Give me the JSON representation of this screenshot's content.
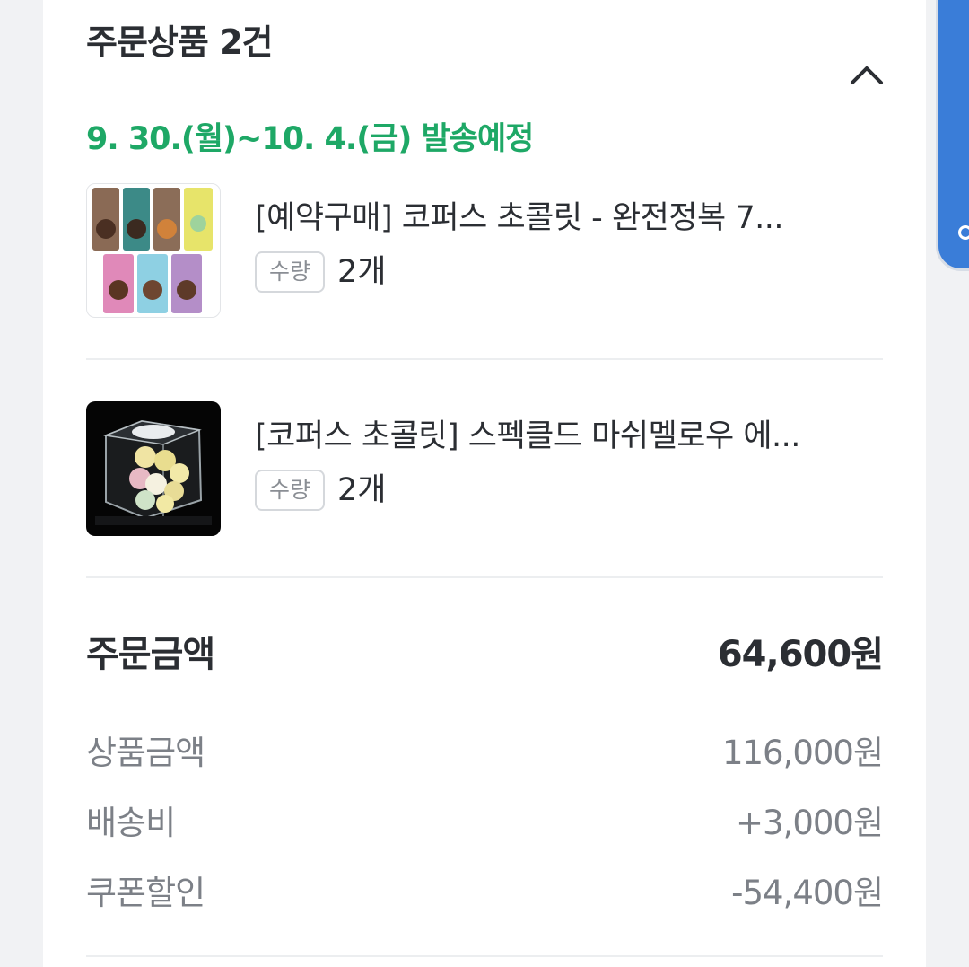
{
  "order": {
    "section_title": "주문상품 2건",
    "ship_date": "9. 30.(월)~10. 4.(금) 발송예정",
    "items": [
      {
        "name": "[예약구매] 코퍼스 초콜릿 - 완전정복 7...",
        "qty_label": "수량",
        "qty_value": "2개"
      },
      {
        "name": "[코퍼스 초콜릿] 스펙클드 마쉬멜로우 에...",
        "qty_label": "수량",
        "qty_value": "2개"
      }
    ]
  },
  "summary": {
    "total_label": "주문금액",
    "total_value": "64,600원",
    "product_label": "상품금액",
    "product_value": "116,000원",
    "shipping_label": "배송비",
    "shipping_value": "+3,000원",
    "coupon_label": "쿠폰할인",
    "coupon_value": "-54,400원"
  },
  "colors": {
    "ship_date": "#1ea866",
    "text_primary": "#2b2e33",
    "text_secondary": "#7c8087",
    "floating_tab": "#3a7dd8"
  }
}
